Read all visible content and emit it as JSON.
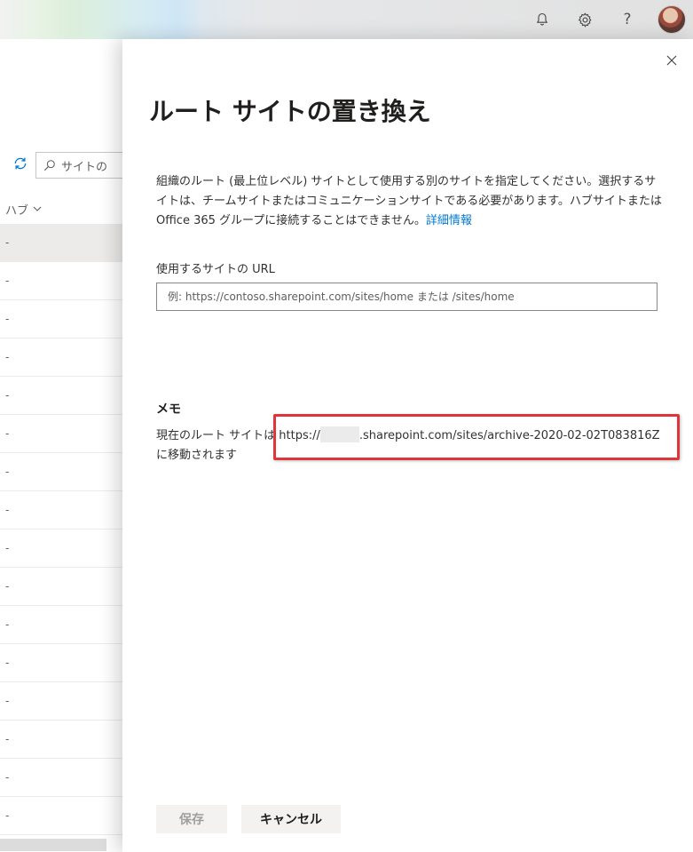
{
  "topbar": {
    "icons": [
      "bell-icon",
      "gear-icon",
      "help-icon",
      "avatar"
    ],
    "help_glyph": "?"
  },
  "background_page": {
    "search_placeholder": "サイトの",
    "column_header": "ハブ",
    "rows": [
      "-",
      "-",
      "-",
      "-",
      "-",
      "-",
      "-",
      "-",
      "-",
      "-",
      "-",
      "-",
      "-",
      "-",
      "-",
      "-"
    ]
  },
  "panel": {
    "title": "ルート サイトの置き換え",
    "description": "組織のルート (最上位レベル) サイトとして使用する別のサイトを指定してください。選択するサイトは、チームサイトまたはコミュニケーションサイトである必要があります。ハブサイトまたは Office 365 グループに接続することはできません。",
    "learn_more_link": "詳細情報",
    "url_label": "使用するサイトの URL",
    "url_value": "",
    "url_placeholder": "例: https://contoso.sharepoint.com/sites/home または /sites/home",
    "memo_heading": "メモ",
    "memo_prefix": "現在のルート サイトは https://",
    "memo_suffix": ".sharepoint.com/sites/archive-2020-02-02T083816Z",
    "memo_line2": "に移動されます",
    "save_label": "保存",
    "cancel_label": "キャンセル"
  },
  "colors": {
    "accent": "#0078d4",
    "highlight": "#e0353a",
    "disabled_text": "#a19f9d"
  }
}
